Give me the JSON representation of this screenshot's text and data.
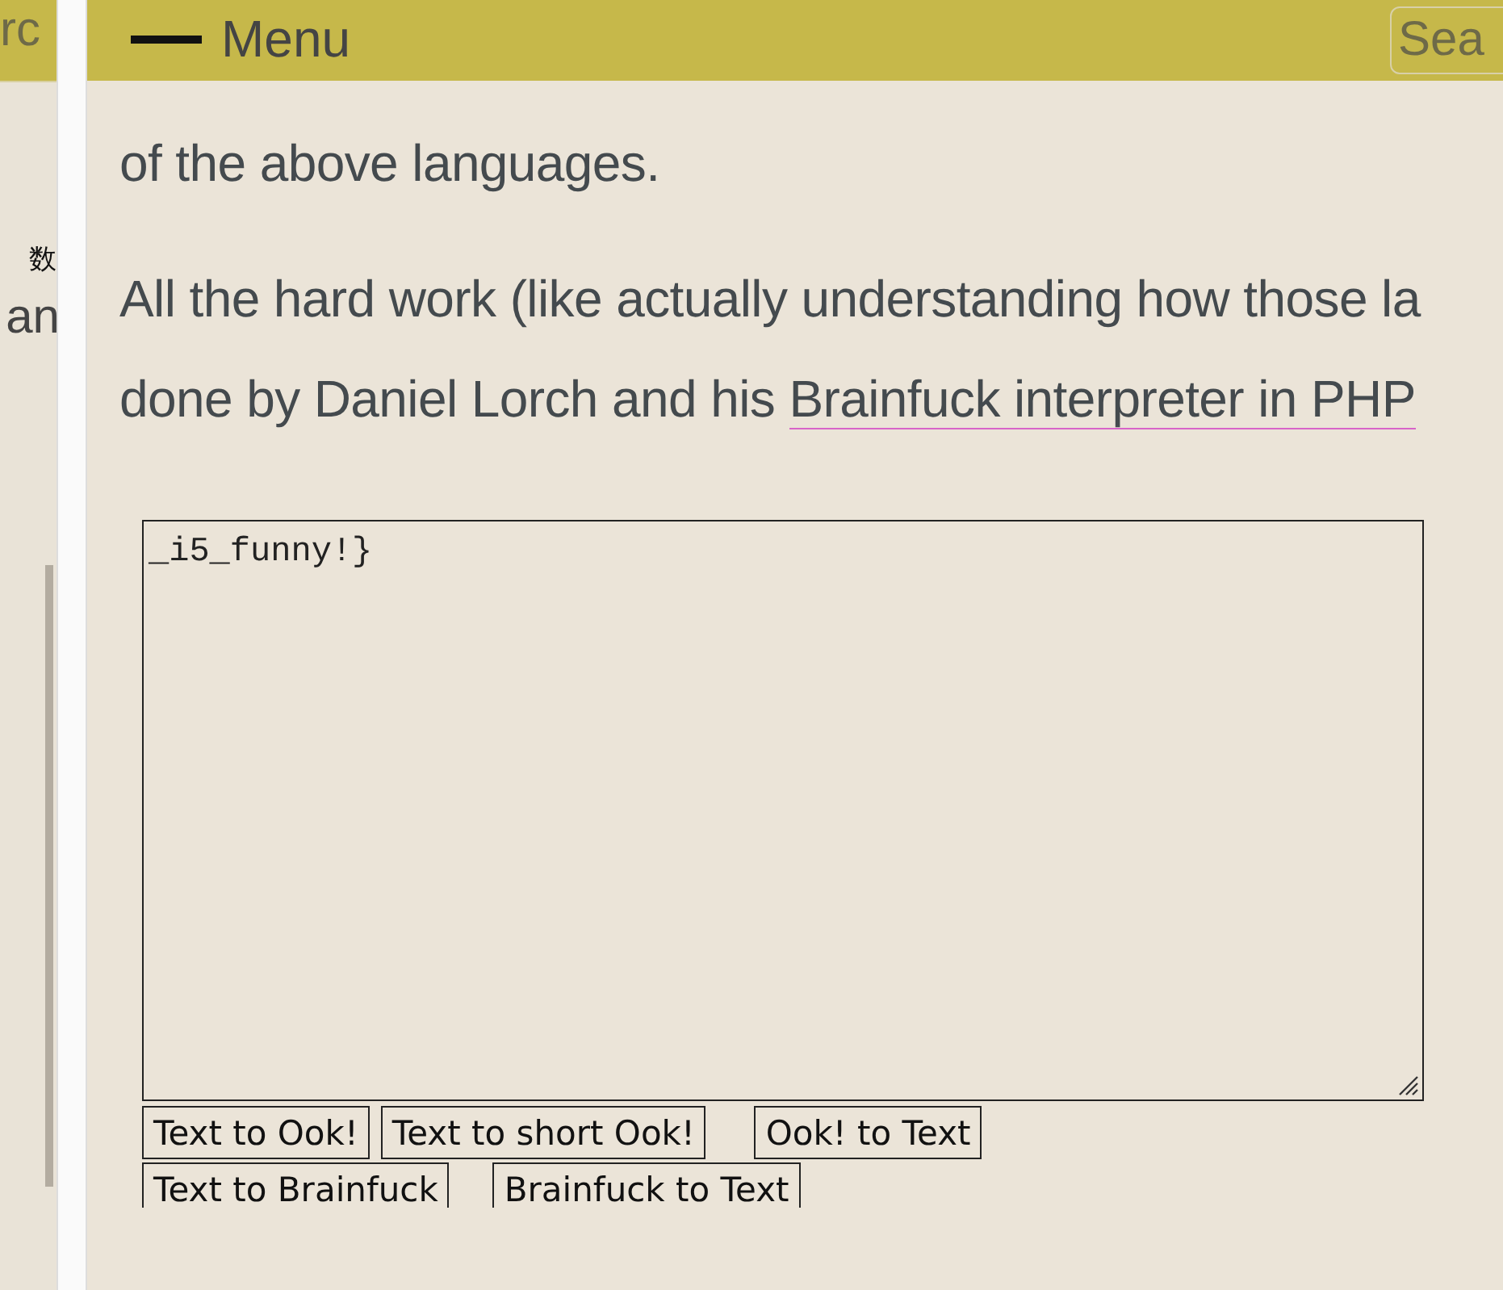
{
  "background_window": {
    "search_text": "rc",
    "cjk_text": "数",
    "text": "an"
  },
  "header": {
    "menu_label": "Menu",
    "search_placeholder": "Sea"
  },
  "paragraphs": [
    {
      "lines": [
        [
          {
            "kind": "text",
            "text": "of the above languages."
          }
        ]
      ]
    },
    {
      "lines": [
        [
          {
            "kind": "text",
            "text": "All the hard work (like actually understanding how those la"
          }
        ],
        [
          {
            "kind": "text",
            "text": "done by Daniel Lorch and his "
          },
          {
            "kind": "link",
            "text": "Brainfuck interpreter in PHP"
          }
        ]
      ]
    }
  ],
  "converter": {
    "value": "_i5_funny!}",
    "button_rows": [
      [
        "Text to Ook!",
        "Text to short Ook!",
        "Ook! to Text"
      ],
      [
        "Text to Brainfuck",
        "Brainfuck to Text"
      ]
    ]
  }
}
